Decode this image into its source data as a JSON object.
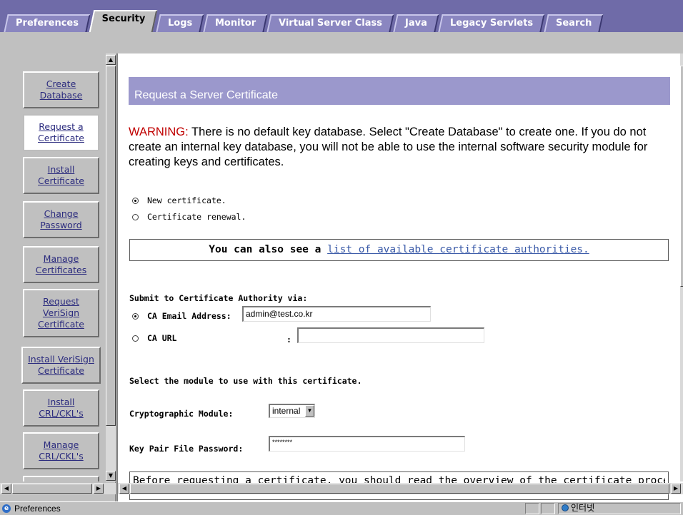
{
  "tabs": [
    {
      "label": "Preferences",
      "active": false
    },
    {
      "label": "Security",
      "active": true
    },
    {
      "label": "Logs",
      "active": false
    },
    {
      "label": "Monitor",
      "active": false
    },
    {
      "label": "Virtual Server Class",
      "active": false
    },
    {
      "label": "Java",
      "active": false
    },
    {
      "label": "Legacy Servlets",
      "active": false
    },
    {
      "label": "Search",
      "active": false
    }
  ],
  "sidebar": {
    "items": [
      {
        "label": "Create\nDatabase"
      },
      {
        "label": "Request a\nCertificate",
        "active": true
      },
      {
        "label": "Install\nCertificate"
      },
      {
        "label": "Change\nPassword"
      },
      {
        "label": "Manage\nCertificates"
      },
      {
        "label": "Request\nVeriSign\nCertificate"
      },
      {
        "label": "Install VeriSign\nCertificate"
      },
      {
        "label": "Install\nCRL/CKL's"
      },
      {
        "label": "Manage\nCRL/CKL's"
      }
    ]
  },
  "main": {
    "title": "Request a Server Certificate",
    "warning_label": "WARNING:",
    "warning_text": " There is no default key database. Select \"Create Database\" to create one. If you do not create an internal key database, you will not be able to use the internal software security module for creating keys and certificates.",
    "cert_type": {
      "new_label": "New certificate.",
      "renewal_label": "Certificate renewal.",
      "selected": "new"
    },
    "info_prefix": "You can also see a",
    "info_link": "list of available certificate authorities.",
    "submit_heading": "Submit to Certificate Authority via:",
    "ca_email_label": "CA Email Address:",
    "ca_email_value": "admin@test.co.kr",
    "ca_url_label": "CA URL",
    "ca_url_colon": ":",
    "ca_url_value": "",
    "submit_selected": "email",
    "module_heading": "Select the module to use with this certificate.",
    "crypto_label": "Cryptographic Module:",
    "crypto_value": "internal",
    "keypair_label": "Key Pair File Password:",
    "keypair_value": "********",
    "bottom_box_text": "Before requesting a certificate, you should read the overview of the certificate process"
  },
  "statusbar": {
    "text": "Preferences",
    "zone": "인터넷"
  }
}
